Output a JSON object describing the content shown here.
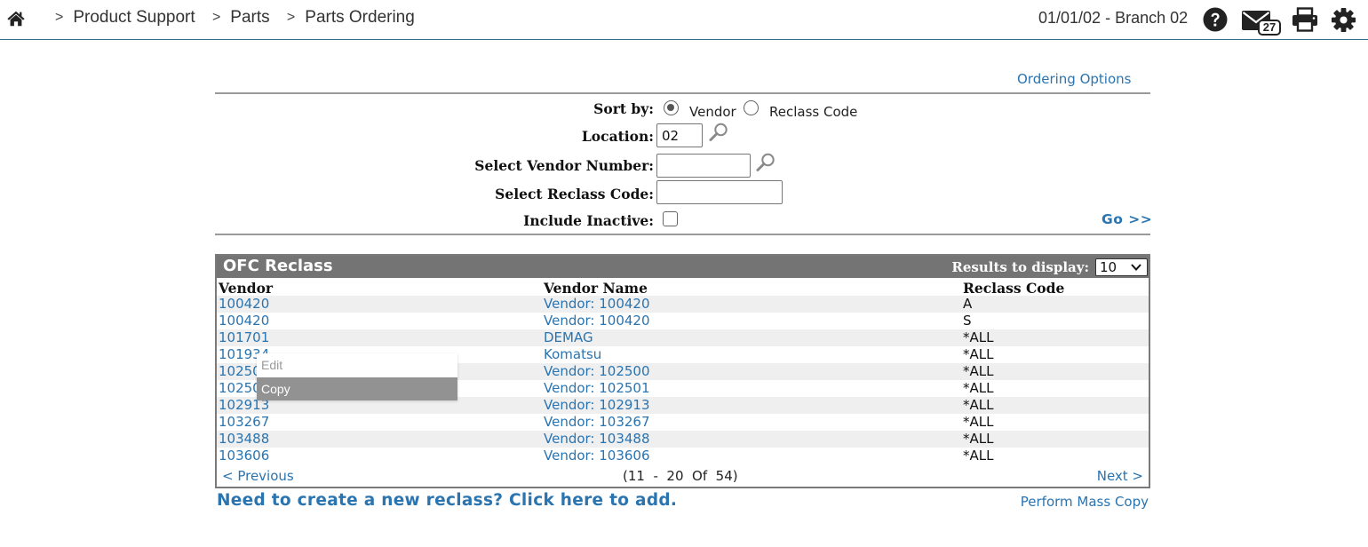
{
  "header": {
    "breadcrumbs": [
      {
        "label": "Product Support"
      },
      {
        "label": "Parts"
      },
      {
        "label": "Parts Ordering"
      }
    ],
    "breadcrumb_separator": ">",
    "date_branch": "01/01/02 - Branch 02",
    "mail_count": "27",
    "icons": [
      "home-icon",
      "help-icon",
      "mail-icon",
      "print-icon",
      "gear-icon"
    ]
  },
  "ordering_options": "Ordering Options",
  "filters": {
    "sort_by_label": "Sort by:",
    "sort_options": [
      {
        "label": "Vendor",
        "checked": true
      },
      {
        "label": "Reclass Code",
        "checked": false
      }
    ],
    "location_label": "Location:",
    "location_value": "02",
    "vendor_number_label": "Select Vendor Number:",
    "vendor_number_value": "",
    "reclass_code_label": "Select Reclass Code:",
    "reclass_code_value": "",
    "include_inactive_label": "Include Inactive:",
    "include_inactive": false,
    "go_label": "Go >>"
  },
  "results": {
    "title": "OFC Reclass",
    "results_to_display_label": "Results to display:",
    "results_to_display_value": "10",
    "columns": [
      "Vendor",
      "Vendor Name",
      "Reclass Code"
    ],
    "rows": [
      [
        "100420",
        "Vendor: 100420",
        "A"
      ],
      [
        "100420",
        "Vendor: 100420",
        "S"
      ],
      [
        "101701",
        "DEMAG",
        "*ALL"
      ],
      [
        "101934",
        "Komatsu",
        "*ALL"
      ],
      [
        "102500",
        "Vendor: 102500",
        "*ALL"
      ],
      [
        "102501",
        "Vendor: 102501",
        "*ALL"
      ],
      [
        "102913",
        "Vendor: 102913",
        "*ALL"
      ],
      [
        "103267",
        "Vendor: 103267",
        "*ALL"
      ],
      [
        "103488",
        "Vendor: 103488",
        "*ALL"
      ],
      [
        "103606",
        "Vendor: 103606",
        "*ALL"
      ]
    ],
    "prev_label": "< Previous",
    "page_info": "(11  -  20  Of  54)",
    "next_label": "Next >"
  },
  "context_menu": {
    "items": [
      {
        "label": "Edit",
        "enabled": false
      },
      {
        "label": "Copy",
        "highlighted": true
      }
    ]
  },
  "footer": {
    "new_reclass_link": "Need to create a new reclass? Click here to add.",
    "mass_copy_link": "Perform Mass Copy"
  },
  "colors": {
    "link": "#2a74b0",
    "panel_header": "#747474",
    "row_alt": "#efefef",
    "menu_highlight": "#929292",
    "topbar_border": "#2e6f8e"
  }
}
